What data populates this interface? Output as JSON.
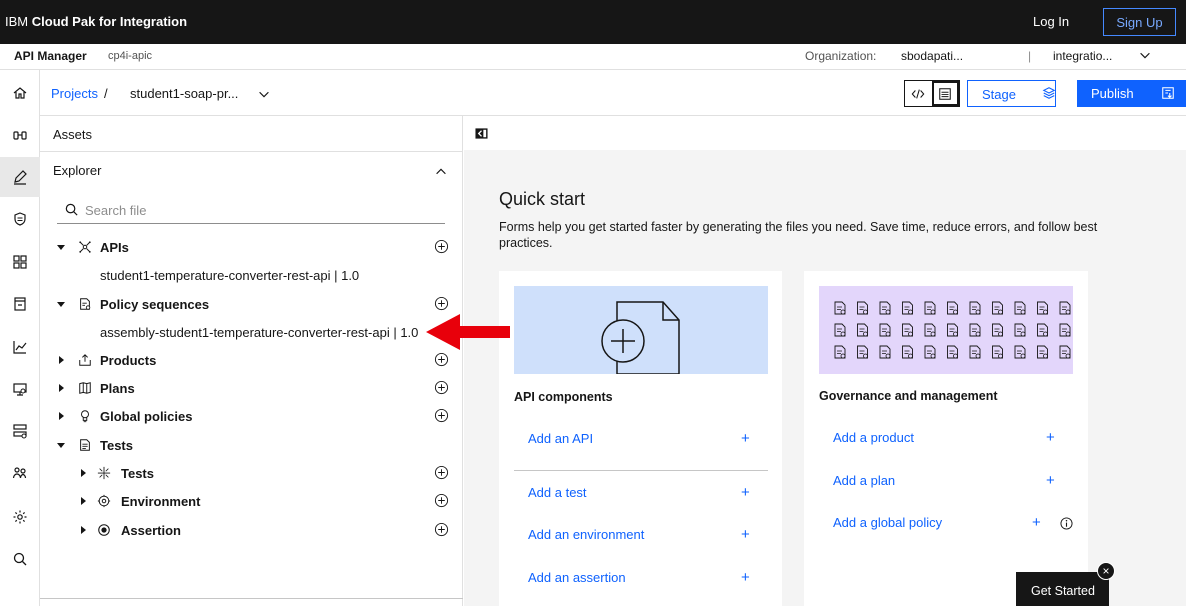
{
  "topbar": {
    "brand_prefix": "IBM",
    "brand_name": "Cloud Pak for Integration",
    "login": "Log In",
    "signup": "Sign Up"
  },
  "subbar": {
    "app_name": "API Manager",
    "instance": "cp4i-apic",
    "org_label": "Organization:",
    "org_value": "sbodapati...",
    "separator": "|",
    "catalog_value": "integratio..."
  },
  "rail": {
    "items": [
      "home-icon",
      "api-icon",
      "develop-icon",
      "test-icon",
      "apps-icon",
      "catalog-icon",
      "analytics-icon",
      "monitor-icon",
      "server-icon",
      "users-icon",
      "settings-icon",
      "search-icon"
    ],
    "active_index": 2
  },
  "breadcrumb": {
    "projects": "Projects",
    "sep": "/",
    "current": "student1-soap-pr..."
  },
  "actions": {
    "stage": "Stage",
    "publish": "Publish"
  },
  "explorer": {
    "assets": "Assets",
    "title": "Explorer",
    "search_placeholder": "Search file",
    "sections": {
      "apis": "APIs",
      "api_item": "student1-temperature-converter-rest-api | 1.0",
      "policy_sequences": "Policy sequences",
      "policy_item": "assembly-student1-temperature-converter-rest-api | 1.0",
      "products": "Products",
      "plans": "Plans",
      "global_policies": "Global policies",
      "tests": "Tests",
      "tests_child": "Tests",
      "environment": "Environment",
      "assertion": "Assertion"
    }
  },
  "quickstart": {
    "title": "Quick start",
    "description": "Forms help you get started faster by generating the files you need. Save time, reduce errors, and follow best practices.",
    "api_components": {
      "title": "API components",
      "links": [
        "Add an API",
        "Add a test",
        "Add an environment",
        "Add an assertion"
      ]
    },
    "governance": {
      "title": "Governance and management",
      "links": [
        "Add a product",
        "Add a plan",
        "Add a global policy"
      ]
    },
    "plus": "+"
  },
  "get_started": {
    "label": "Get Started",
    "close": "×"
  },
  "colors": {
    "accent": "#0f62fe",
    "topbar": "#161616",
    "annotation": "#e8000b",
    "illus_api": "#cfe0fb",
    "illus_gov": "#e3d6fb"
  }
}
